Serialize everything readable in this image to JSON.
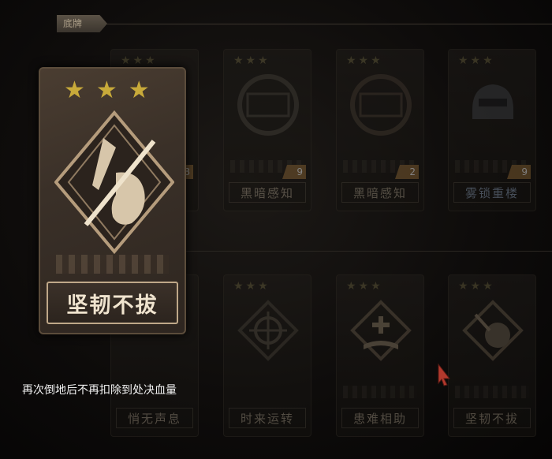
{
  "tab": {
    "label": "底牌"
  },
  "selected_card": {
    "stars": "★★★",
    "name": "坚韧不拔",
    "description": "再次倒地后不再扣除到处决血量"
  },
  "cards_row1": [
    {
      "stars": "★★★",
      "name": "",
      "count": "8"
    },
    {
      "stars": "★★★",
      "name": "黑暗感知",
      "count": "9"
    },
    {
      "stars": "★★★",
      "name": "黑暗感知",
      "count": "2"
    },
    {
      "stars": "★★★",
      "name": "雾锁重楼",
      "count": "9"
    }
  ],
  "cards_row2": [
    {
      "stars": "★★★",
      "name": "悄无声息"
    },
    {
      "stars": "★★★",
      "name": "时来运转"
    },
    {
      "stars": "★★★",
      "name": "患难相助"
    },
    {
      "stars": "★★★",
      "name": "坚韧不拔"
    }
  ],
  "colors": {
    "gold": "#c8aa3a",
    "text": "#f0e4cf",
    "accent_cursor": "#c0392b"
  }
}
